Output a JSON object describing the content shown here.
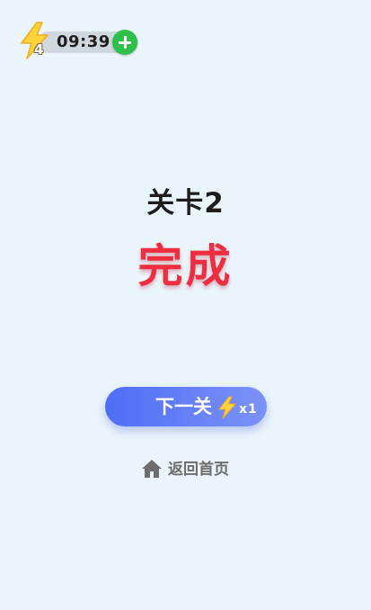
{
  "energy": {
    "count": "4",
    "timer": "09:39",
    "bolt_icon": "lightning-bolt-icon",
    "add_icon": "plus-icon",
    "bolt_color": "#ffd23f",
    "add_color": "#2fc04b"
  },
  "level": {
    "title": "关卡2",
    "status": "完成",
    "status_color": "#ec2e40"
  },
  "next_button": {
    "label": "下一关",
    "cost": "x1",
    "icon": "lightning-bolt-icon",
    "gradient_start": "#4d6ef6",
    "gradient_end": "#7d92f7"
  },
  "home_link": {
    "label": "返回首页",
    "icon": "home-icon"
  },
  "colors": {
    "background": "#eaf5fb"
  }
}
